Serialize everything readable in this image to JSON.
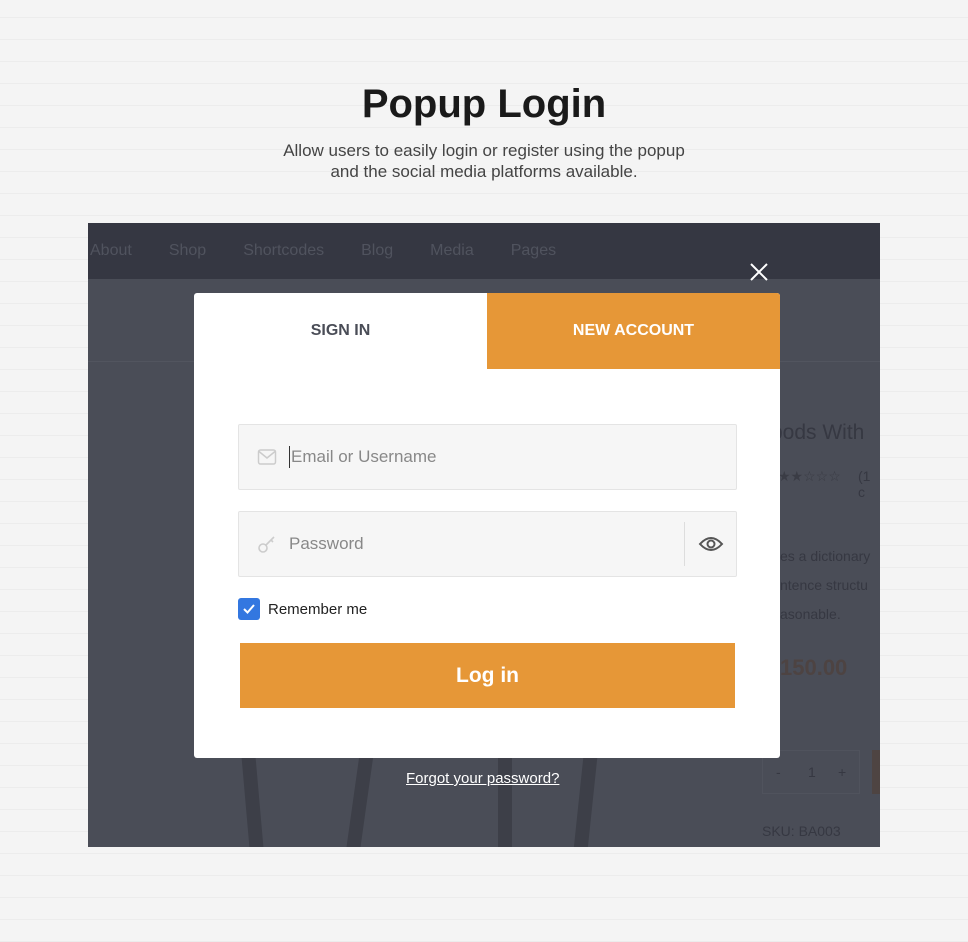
{
  "header": {
    "title": "Popup Login",
    "subtitle_line1": "Allow users to easily login or register using the popup",
    "subtitle_line2": "and the social media platforms available."
  },
  "nav": [
    "About",
    "Shop",
    "Shortcodes",
    "Blog",
    "Media",
    "Pages"
  ],
  "background": {
    "product_title": "rpods With",
    "reviews": "(1 c",
    "desc1": "es a dictionary",
    "desc2": "ntence structu",
    "desc3": "asonable.",
    "price": "150.00",
    "qty": "1",
    "minus": "-",
    "plus": "+",
    "sku": "SKU: BA003"
  },
  "modal": {
    "tabs": {
      "sign_in": "SIGN IN",
      "new_account": "NEW ACCOUNT"
    },
    "email_placeholder": "Email or Username",
    "password_placeholder": "Password",
    "remember_label": "Remember me",
    "remember_checked": true,
    "login_label": "Log in",
    "forgot_label": "Forgot your password?"
  },
  "colors": {
    "accent": "#e69737",
    "checkbox": "#3377e0",
    "overlay": "#4a4d57"
  }
}
